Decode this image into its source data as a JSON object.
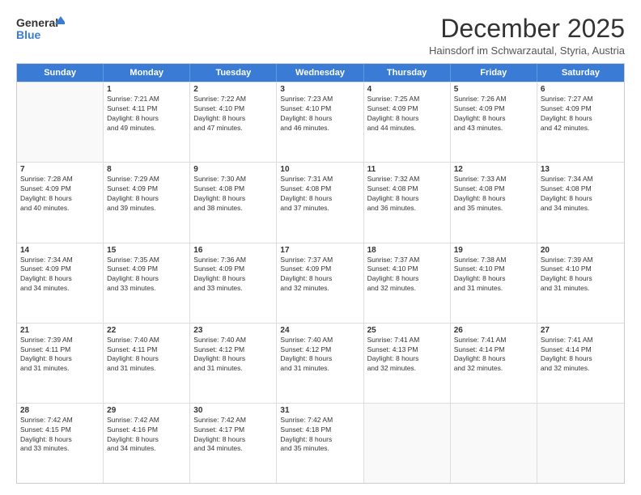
{
  "header": {
    "logo_line1": "General",
    "logo_line2": "Blue",
    "title": "December 2025",
    "subtitle": "Hainsdorf im Schwarzautal, Styria, Austria"
  },
  "days": [
    "Sunday",
    "Monday",
    "Tuesday",
    "Wednesday",
    "Thursday",
    "Friday",
    "Saturday"
  ],
  "rows": [
    [
      {
        "num": "",
        "lines": [],
        "empty": true
      },
      {
        "num": "1",
        "lines": [
          "Sunrise: 7:21 AM",
          "Sunset: 4:11 PM",
          "Daylight: 8 hours",
          "and 49 minutes."
        ]
      },
      {
        "num": "2",
        "lines": [
          "Sunrise: 7:22 AM",
          "Sunset: 4:10 PM",
          "Daylight: 8 hours",
          "and 47 minutes."
        ]
      },
      {
        "num": "3",
        "lines": [
          "Sunrise: 7:23 AM",
          "Sunset: 4:10 PM",
          "Daylight: 8 hours",
          "and 46 minutes."
        ]
      },
      {
        "num": "4",
        "lines": [
          "Sunrise: 7:25 AM",
          "Sunset: 4:09 PM",
          "Daylight: 8 hours",
          "and 44 minutes."
        ]
      },
      {
        "num": "5",
        "lines": [
          "Sunrise: 7:26 AM",
          "Sunset: 4:09 PM",
          "Daylight: 8 hours",
          "and 43 minutes."
        ]
      },
      {
        "num": "6",
        "lines": [
          "Sunrise: 7:27 AM",
          "Sunset: 4:09 PM",
          "Daylight: 8 hours",
          "and 42 minutes."
        ]
      }
    ],
    [
      {
        "num": "7",
        "lines": [
          "Sunrise: 7:28 AM",
          "Sunset: 4:09 PM",
          "Daylight: 8 hours",
          "and 40 minutes."
        ]
      },
      {
        "num": "8",
        "lines": [
          "Sunrise: 7:29 AM",
          "Sunset: 4:09 PM",
          "Daylight: 8 hours",
          "and 39 minutes."
        ]
      },
      {
        "num": "9",
        "lines": [
          "Sunrise: 7:30 AM",
          "Sunset: 4:08 PM",
          "Daylight: 8 hours",
          "and 38 minutes."
        ]
      },
      {
        "num": "10",
        "lines": [
          "Sunrise: 7:31 AM",
          "Sunset: 4:08 PM",
          "Daylight: 8 hours",
          "and 37 minutes."
        ]
      },
      {
        "num": "11",
        "lines": [
          "Sunrise: 7:32 AM",
          "Sunset: 4:08 PM",
          "Daylight: 8 hours",
          "and 36 minutes."
        ]
      },
      {
        "num": "12",
        "lines": [
          "Sunrise: 7:33 AM",
          "Sunset: 4:08 PM",
          "Daylight: 8 hours",
          "and 35 minutes."
        ]
      },
      {
        "num": "13",
        "lines": [
          "Sunrise: 7:34 AM",
          "Sunset: 4:08 PM",
          "Daylight: 8 hours",
          "and 34 minutes."
        ]
      }
    ],
    [
      {
        "num": "14",
        "lines": [
          "Sunrise: 7:34 AM",
          "Sunset: 4:09 PM",
          "Daylight: 8 hours",
          "and 34 minutes."
        ]
      },
      {
        "num": "15",
        "lines": [
          "Sunrise: 7:35 AM",
          "Sunset: 4:09 PM",
          "Daylight: 8 hours",
          "and 33 minutes."
        ]
      },
      {
        "num": "16",
        "lines": [
          "Sunrise: 7:36 AM",
          "Sunset: 4:09 PM",
          "Daylight: 8 hours",
          "and 33 minutes."
        ]
      },
      {
        "num": "17",
        "lines": [
          "Sunrise: 7:37 AM",
          "Sunset: 4:09 PM",
          "Daylight: 8 hours",
          "and 32 minutes."
        ]
      },
      {
        "num": "18",
        "lines": [
          "Sunrise: 7:37 AM",
          "Sunset: 4:10 PM",
          "Daylight: 8 hours",
          "and 32 minutes."
        ]
      },
      {
        "num": "19",
        "lines": [
          "Sunrise: 7:38 AM",
          "Sunset: 4:10 PM",
          "Daylight: 8 hours",
          "and 31 minutes."
        ]
      },
      {
        "num": "20",
        "lines": [
          "Sunrise: 7:39 AM",
          "Sunset: 4:10 PM",
          "Daylight: 8 hours",
          "and 31 minutes."
        ]
      }
    ],
    [
      {
        "num": "21",
        "lines": [
          "Sunrise: 7:39 AM",
          "Sunset: 4:11 PM",
          "Daylight: 8 hours",
          "and 31 minutes."
        ]
      },
      {
        "num": "22",
        "lines": [
          "Sunrise: 7:40 AM",
          "Sunset: 4:11 PM",
          "Daylight: 8 hours",
          "and 31 minutes."
        ]
      },
      {
        "num": "23",
        "lines": [
          "Sunrise: 7:40 AM",
          "Sunset: 4:12 PM",
          "Daylight: 8 hours",
          "and 31 minutes."
        ]
      },
      {
        "num": "24",
        "lines": [
          "Sunrise: 7:40 AM",
          "Sunset: 4:12 PM",
          "Daylight: 8 hours",
          "and 31 minutes."
        ]
      },
      {
        "num": "25",
        "lines": [
          "Sunrise: 7:41 AM",
          "Sunset: 4:13 PM",
          "Daylight: 8 hours",
          "and 32 minutes."
        ]
      },
      {
        "num": "26",
        "lines": [
          "Sunrise: 7:41 AM",
          "Sunset: 4:14 PM",
          "Daylight: 8 hours",
          "and 32 minutes."
        ]
      },
      {
        "num": "27",
        "lines": [
          "Sunrise: 7:41 AM",
          "Sunset: 4:14 PM",
          "Daylight: 8 hours",
          "and 32 minutes."
        ]
      }
    ],
    [
      {
        "num": "28",
        "lines": [
          "Sunrise: 7:42 AM",
          "Sunset: 4:15 PM",
          "Daylight: 8 hours",
          "and 33 minutes."
        ]
      },
      {
        "num": "29",
        "lines": [
          "Sunrise: 7:42 AM",
          "Sunset: 4:16 PM",
          "Daylight: 8 hours",
          "and 34 minutes."
        ]
      },
      {
        "num": "30",
        "lines": [
          "Sunrise: 7:42 AM",
          "Sunset: 4:17 PM",
          "Daylight: 8 hours",
          "and 34 minutes."
        ]
      },
      {
        "num": "31",
        "lines": [
          "Sunrise: 7:42 AM",
          "Sunset: 4:18 PM",
          "Daylight: 8 hours",
          "and 35 minutes."
        ]
      },
      {
        "num": "",
        "lines": [],
        "empty": true
      },
      {
        "num": "",
        "lines": [],
        "empty": true
      },
      {
        "num": "",
        "lines": [],
        "empty": true
      }
    ]
  ]
}
